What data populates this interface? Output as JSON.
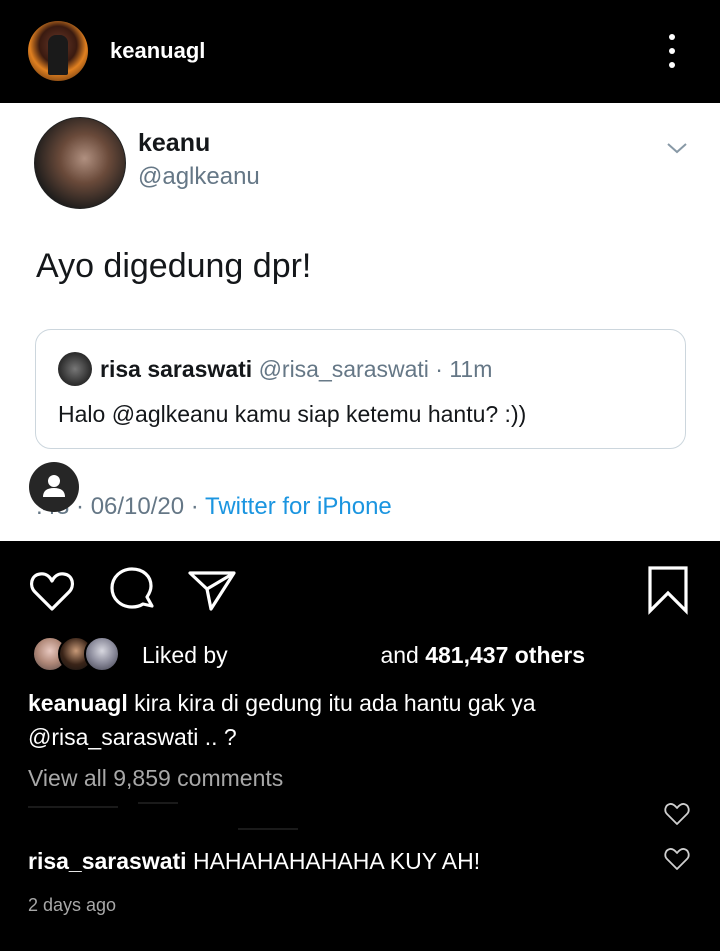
{
  "header": {
    "username": "keanuagl"
  },
  "tweet": {
    "name": "keanu",
    "handle": "@aglkeanu",
    "text": "Ayo digedung dpr!",
    "quote": {
      "name": "risa saraswati",
      "meta": "@risa_saraswati · 11m",
      "text": "Halo @aglkeanu kamu siap ketemu hantu? :))"
    },
    "footer_time": "1 :43 · 06/10/20 · ",
    "footer_time_visible": "​​:43 · 06/10/20 · ",
    "source": "Twitter for iPhone"
  },
  "likes": {
    "prefix": "Liked by",
    "suffix": "and",
    "count": "481,437 others"
  },
  "caption": {
    "username": "keanuagl",
    "text": "kira kira di gedung itu ada hantu gak ya @risa_saraswati .. ?"
  },
  "comments": {
    "view_all": "View all 9,859 comments",
    "items": [
      {
        "username": "risa_saraswati",
        "text": "HAHAHAHAHAHA KUY AH!"
      }
    ]
  },
  "timestamp": "2 days ago",
  "icons": [
    "more-vertical-icon",
    "chevron-down-icon",
    "heart-icon",
    "comment-icon",
    "share-icon",
    "bookmark-icon",
    "user-icon"
  ],
  "colors": {
    "twitter_blue": "#1b95e0",
    "secondary_gray": "#657786",
    "ig_gray": "#a8a8a8"
  }
}
